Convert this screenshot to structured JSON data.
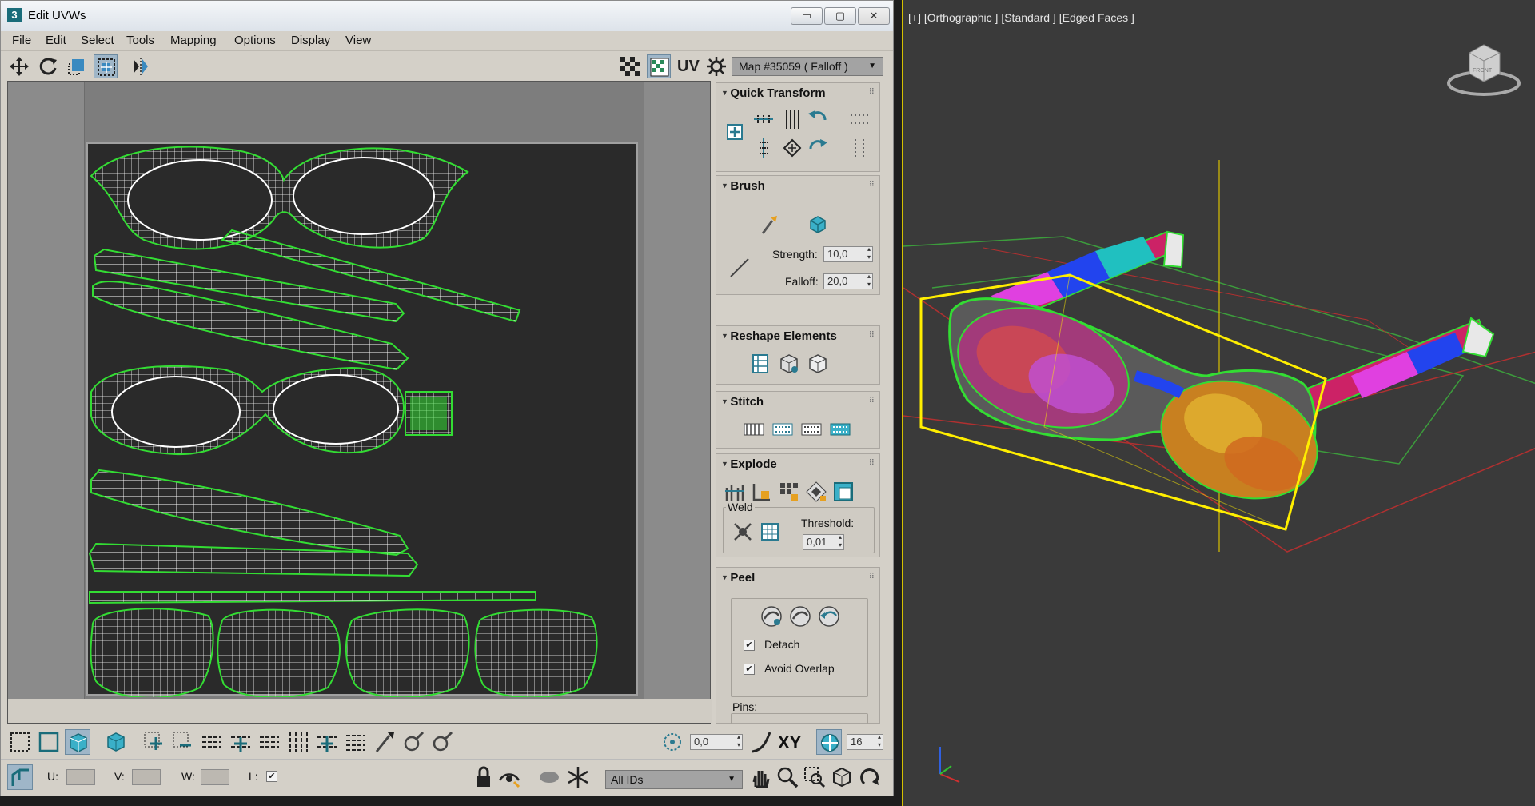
{
  "window": {
    "title": "Edit UVWs",
    "app_icon": "3",
    "controls": {
      "minimize": "▭",
      "maximize": "▢",
      "close": "✕"
    }
  },
  "menu": [
    "File",
    "Edit",
    "Select",
    "Tools",
    "Mapping",
    "Options",
    "Display",
    "View"
  ],
  "toolbar_top": {
    "uv_label": "UV",
    "map_select": "Map #35059  ( Falloff )"
  },
  "panel": {
    "quick_transform": {
      "title": "Quick Transform"
    },
    "brush": {
      "title": "Brush",
      "strength_label": "Strength:",
      "strength_value": "10,0",
      "falloff_label": "Falloff:",
      "falloff_value": "20,0"
    },
    "reshape": {
      "title": "Reshape Elements"
    },
    "stitch": {
      "title": "Stitch"
    },
    "explode": {
      "title": "Explode",
      "weld_label": "Weld",
      "threshold_label": "Threshold:",
      "threshold_value": "0,01"
    },
    "peel": {
      "title": "Peel",
      "detach_label": "Detach",
      "detach_checked": "✔",
      "avoid_overlap_label": "Avoid Overlap",
      "avoid_overlap_checked": "✔",
      "pins_label": "Pins:"
    }
  },
  "toolbar_bottom": {
    "angle_value": "0,0",
    "xy_label": "XY",
    "grid_value": "16",
    "u_label": "U:",
    "v_label": "V:",
    "w_label": "W:",
    "l_label": "L:",
    "l_checked": "✔",
    "ids_select": "All IDs"
  },
  "viewport": {
    "label": "[+] [Orthographic ] [Standard ] [Edged Faces ]",
    "viewcube_face": "FRONT"
  },
  "colors": {
    "uv_wire": "#ffffff",
    "uv_selection": "#33dd33",
    "bbox": "#ffee00",
    "viewport_bg": "#3a3a3a",
    "gizmo": "#d8c000"
  }
}
